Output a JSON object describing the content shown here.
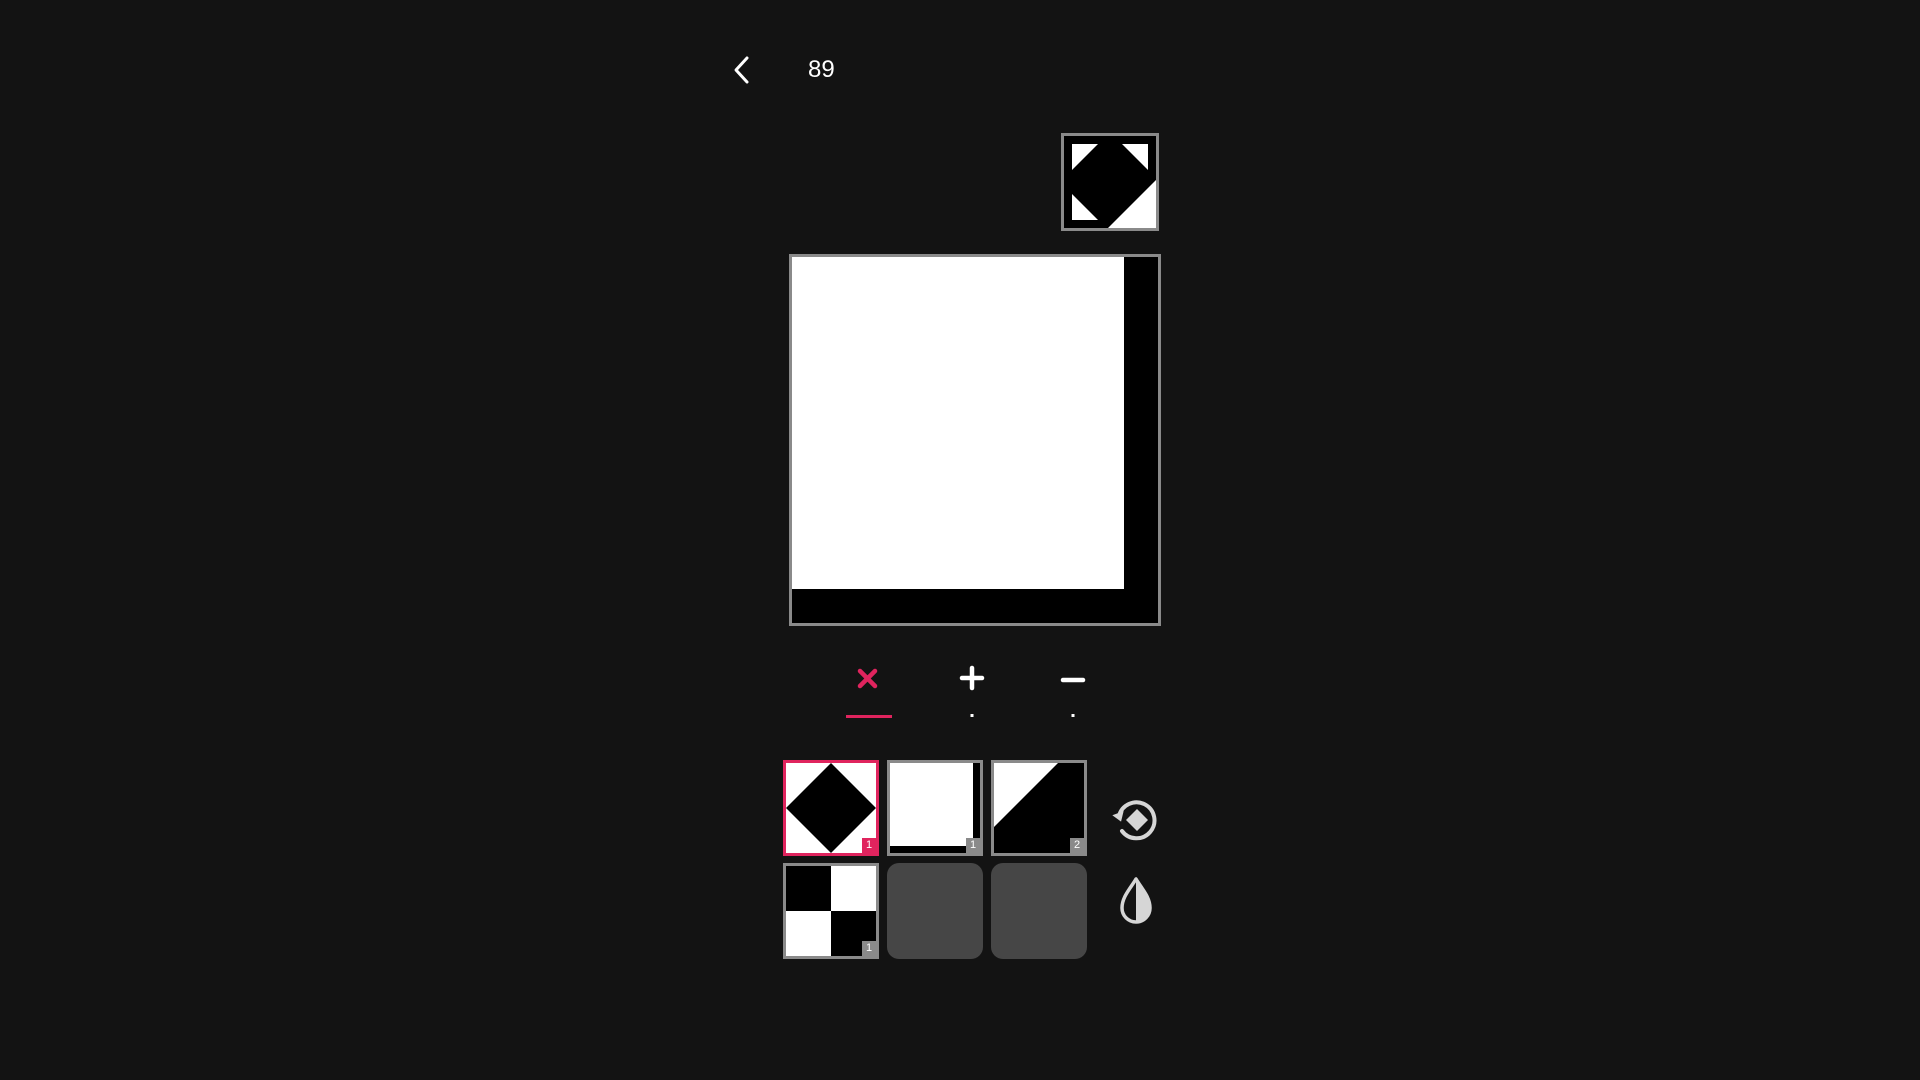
{
  "header": {
    "back_icon": "chevron-left-icon",
    "level_number": "89"
  },
  "colors": {
    "background": "#131313",
    "accent": "#e0245e",
    "border": "#8a8a8a",
    "empty_slot": "#464646"
  },
  "modes": [
    {
      "id": "cross",
      "icon": "x-icon",
      "active": true
    },
    {
      "id": "plus",
      "icon": "plus-icon",
      "active": false
    },
    {
      "id": "minus",
      "icon": "minus-icon",
      "active": false
    }
  ],
  "tiles": [
    {
      "pattern": "diamond",
      "count": "1",
      "selected": true
    },
    {
      "pattern": "white-with-black-edges",
      "count": "1",
      "selected": false
    },
    {
      "pattern": "diagonal-triangle",
      "count": "2",
      "selected": false
    },
    {
      "pattern": "checker",
      "count": "1",
      "selected": false
    },
    {
      "pattern": "empty"
    },
    {
      "pattern": "empty"
    }
  ],
  "side_buttons": [
    {
      "id": "rotate",
      "icon": "rotate-icon"
    },
    {
      "id": "invert",
      "icon": "droplet-icon"
    }
  ]
}
